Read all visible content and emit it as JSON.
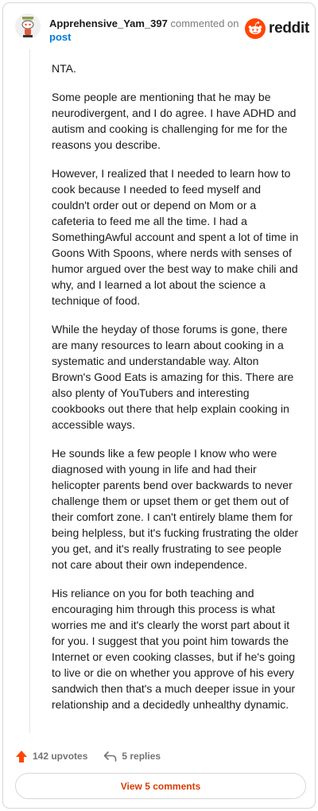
{
  "comment": {
    "username": "Apprehensive_Yam_397",
    "commented_text": "commented on",
    "post_link": "post",
    "paragraphs": [
      "NTA.",
      "Some people are mentioning that he may be neurodivergent, and I do agree. I have ADHD and autism and cooking is challenging for me for the reasons you describe.",
      "However, I realized that I needed to learn how to cook because I needed to feed myself and couldn't order out or depend on Mom or a cafeteria to feed me all the time. I had a SomethingAwful account and spent a lot of time in Goons With Spoons, where nerds with senses of humor argued over the best way to make chili and why, and I learned a lot about the science a technique of food.",
      "While the heyday of those forums is gone, there are many resources to learn about cooking in a systematic and understandable way. Alton Brown's Good Eats is amazing for this. There are also plenty of YouTubers and interesting cookbooks out there that help explain cooking in accessible ways.",
      "He sounds like a few people I know who were diagnosed with young in life and had their helicopter parents bend over backwards to never challenge them or upset them or get them out of their comfort zone. I can't entirely blame them for being helpless, but it's fucking frustrating the older you get, and it's really frustrating to see people not care about their own independence.",
      "His reliance on you for both teaching and encouraging him through this process is what worries me and it's clearly the worst part about it for you. I suggest that you point him towards the Internet or even cooking classes, but if he's going to live or die on whether you approve of his every sandwich then that's a much deeper issue in your relationship and a decidedly unhealthy dynamic."
    ],
    "upvotes": "142 upvotes",
    "replies": "5 replies"
  },
  "brand": {
    "wordmark": "reddit",
    "icon": "reddit-snoo-icon",
    "color": "#ff4500"
  },
  "footer": {
    "view_comments_label": "View 5 comments"
  },
  "colors": {
    "accent_orange": "#d93a00",
    "link_blue": "#0079d3",
    "upvote": "#ff4500"
  }
}
